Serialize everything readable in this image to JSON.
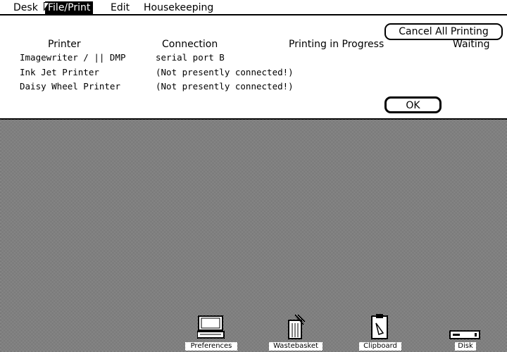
{
  "menubar": {
    "items": [
      {
        "label": "Desk"
      },
      {
        "label": "File/Print"
      },
      {
        "label": "Edit"
      },
      {
        "label": "Housekeeping"
      }
    ],
    "active_index": 1
  },
  "print_dialog": {
    "cancel_all_label": "Cancel All Printing",
    "ok_label": "OK",
    "columns": {
      "printer": "Printer",
      "connection": "Connection",
      "printing": "Printing in Progress",
      "waiting": "Waiting"
    },
    "printers": [
      {
        "name": "Imagewriter / || DMP",
        "connection": "serial port B"
      },
      {
        "name": "Ink Jet Printer",
        "connection": "(Not presently connected!)"
      },
      {
        "name": "Daisy Wheel Printer",
        "connection": "(Not presently connected!)"
      }
    ]
  },
  "desktop": {
    "icons": [
      {
        "label": "Preferences",
        "icon": "computer-icon"
      },
      {
        "label": "Wastebasket",
        "icon": "wastebasket-icon"
      },
      {
        "label": "Clipboard",
        "icon": "clipboard-icon"
      },
      {
        "label": "Disk",
        "icon": "disk-icon"
      }
    ]
  }
}
